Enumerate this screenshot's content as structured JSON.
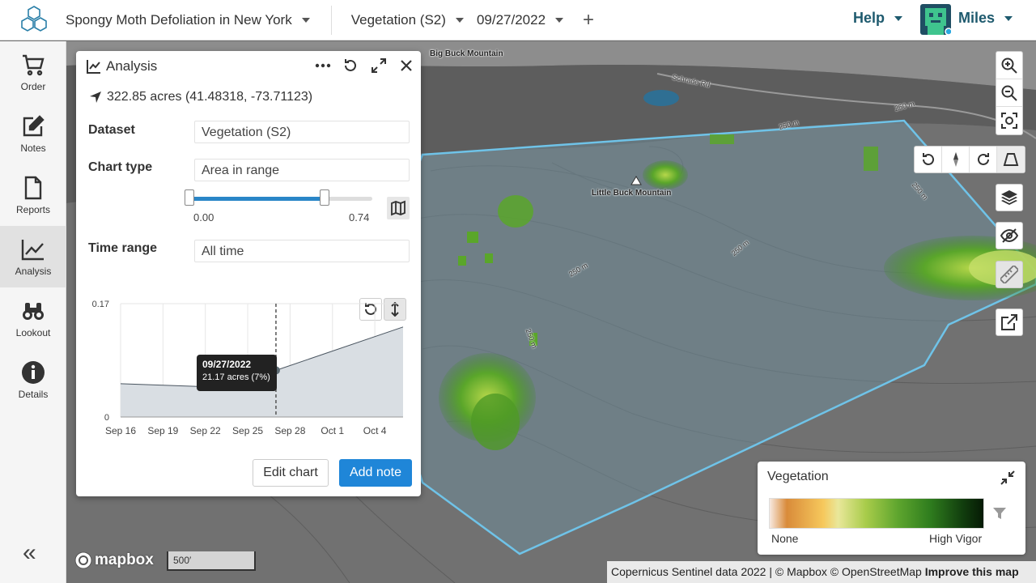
{
  "header": {
    "project_title": "Spongy Moth Defoliation in New York",
    "dataset": "Vegetation (S2)",
    "date": "09/27/2022",
    "help_label": "Help",
    "user_name": "Miles"
  },
  "sidebar": {
    "items": [
      {
        "label": "Order",
        "icon": "cart-icon"
      },
      {
        "label": "Notes",
        "icon": "edit-icon"
      },
      {
        "label": "Reports",
        "icon": "document-icon"
      },
      {
        "label": "Analysis",
        "icon": "chart-line-icon"
      },
      {
        "label": "Lookout",
        "icon": "binoculars-icon"
      },
      {
        "label": "Details",
        "icon": "info-icon"
      }
    ],
    "active": "Analysis"
  },
  "analysis_panel": {
    "title": "Analysis",
    "area_text": "322.85 acres (41.48318, -73.71123)",
    "dataset_label": "Dataset",
    "dataset_value": "Vegetation (S2)",
    "chart_type_label": "Chart type",
    "chart_type_value": "Area in range",
    "range_min": "0.00",
    "range_max": "0.74",
    "range_fill_fraction": 0.74,
    "time_range_label": "Time range",
    "time_range_value": "All time",
    "tooltip_date": "09/27/2022",
    "tooltip_value": "21.17 acres (7%)",
    "edit_button": "Edit chart",
    "add_note_button": "Add note"
  },
  "chart_data": {
    "type": "area",
    "x": [
      "Sep 16",
      "Sep 24",
      "Sep 27",
      "Oct 6"
    ],
    "y": [
      0.05,
      0.044,
      0.07,
      0.135
    ],
    "y_unit": "",
    "yticks": [
      "0",
      "0.17"
    ],
    "ylim": [
      0,
      0.17
    ],
    "xticks": [
      "Sep 16",
      "Sep 19",
      "Sep 22",
      "Sep 25",
      "Sep 28",
      "Oct 1",
      "Oct 4"
    ],
    "xlim": [
      "Sep 16",
      "Oct 6"
    ],
    "highlight_x": "Sep 27",
    "grid": true,
    "color": "#d9dee3",
    "line_color": "#4a5560"
  },
  "map": {
    "labels": {
      "big_buck": "Big Buck Mountain",
      "little_buck": "Little Buck Mountain",
      "schrade": "Schrade Rd",
      "contour_250": "250 m"
    },
    "scale": "500′",
    "mapbox": "mapbox",
    "attribution_prefix": "Copernicus Sentinel data 2022 | © Mapbox © OpenStreetMap",
    "improve": "Improve this map"
  },
  "legend": {
    "title": "Vegetation",
    "min_label": "None",
    "max_label": "High Vigor"
  },
  "colors": {
    "accent": "#1f86d8",
    "brand": "#1e5a6e",
    "aoi_outline": "#6fc3e8"
  }
}
